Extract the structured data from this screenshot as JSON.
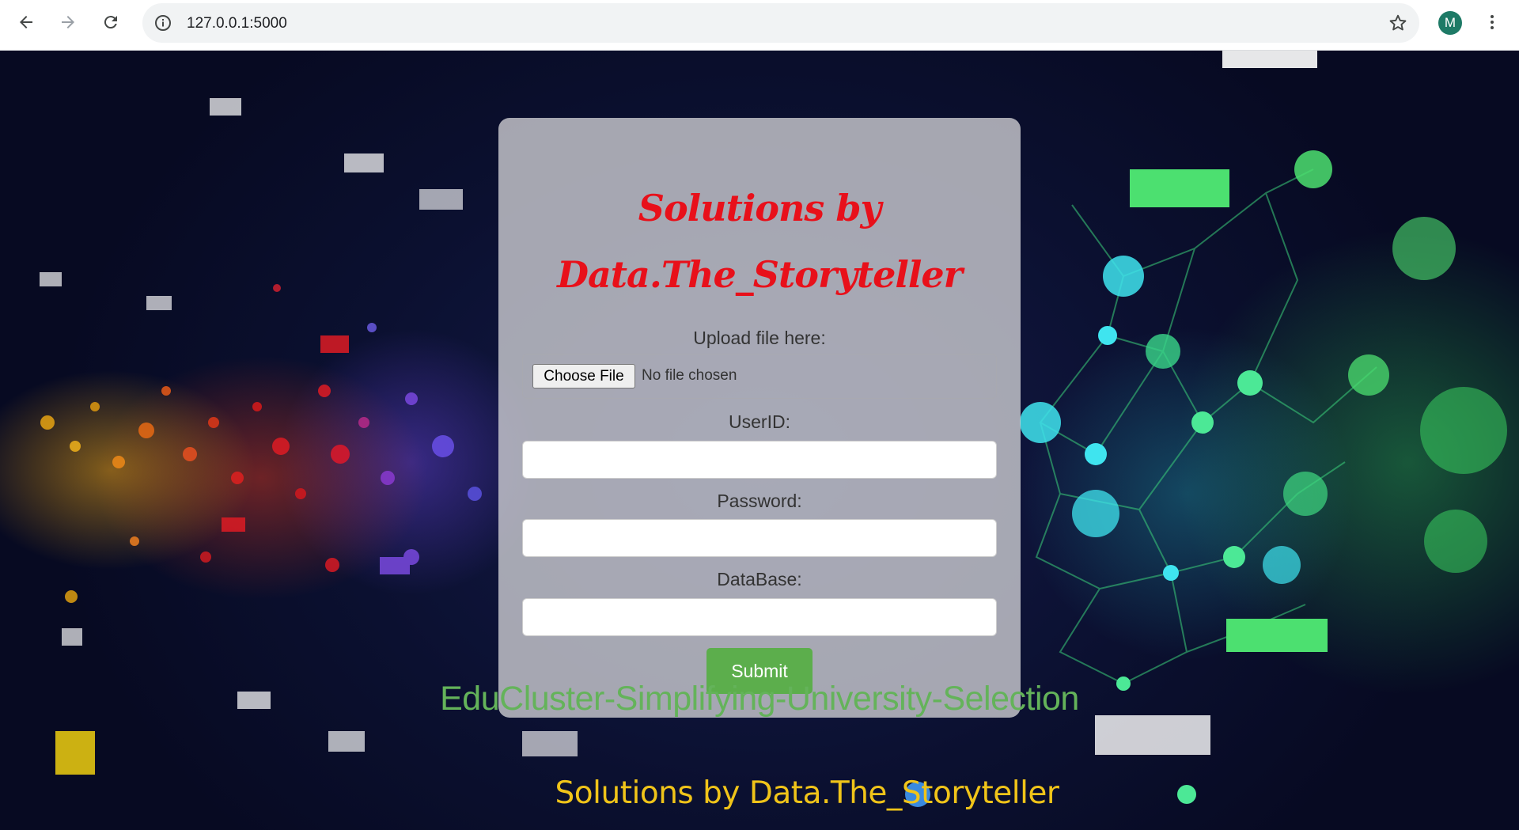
{
  "browser": {
    "url": "127.0.0.1:5000",
    "profile_initial": "M"
  },
  "icons": {
    "back": "arrow-left-icon",
    "forward": "arrow-right-icon",
    "reload": "reload-icon",
    "site_info": "info-icon",
    "bookmark": "star-icon",
    "menu": "kebab-menu-icon"
  },
  "colors": {
    "title_red": "#e8101a",
    "submit_green": "#5cae4c",
    "project_title_green": "#64b35a",
    "footer_yellow": "#f0c419"
  },
  "form": {
    "title_line1": "Solutions by",
    "title_line2": "Data.The_Storyteller",
    "upload_label": "Upload file here:",
    "choose_file_label": "Choose File",
    "file_status": "No file chosen",
    "userid_label": "UserID:",
    "userid_value": "",
    "password_label": "Password:",
    "password_value": "",
    "database_label": "DataBase:",
    "database_value": "",
    "submit_label": "Submit"
  },
  "page": {
    "project_title": "EduCluster-Simplifying-University-Selection",
    "footer_credit": "Solutions by Data.The_Storyteller"
  }
}
